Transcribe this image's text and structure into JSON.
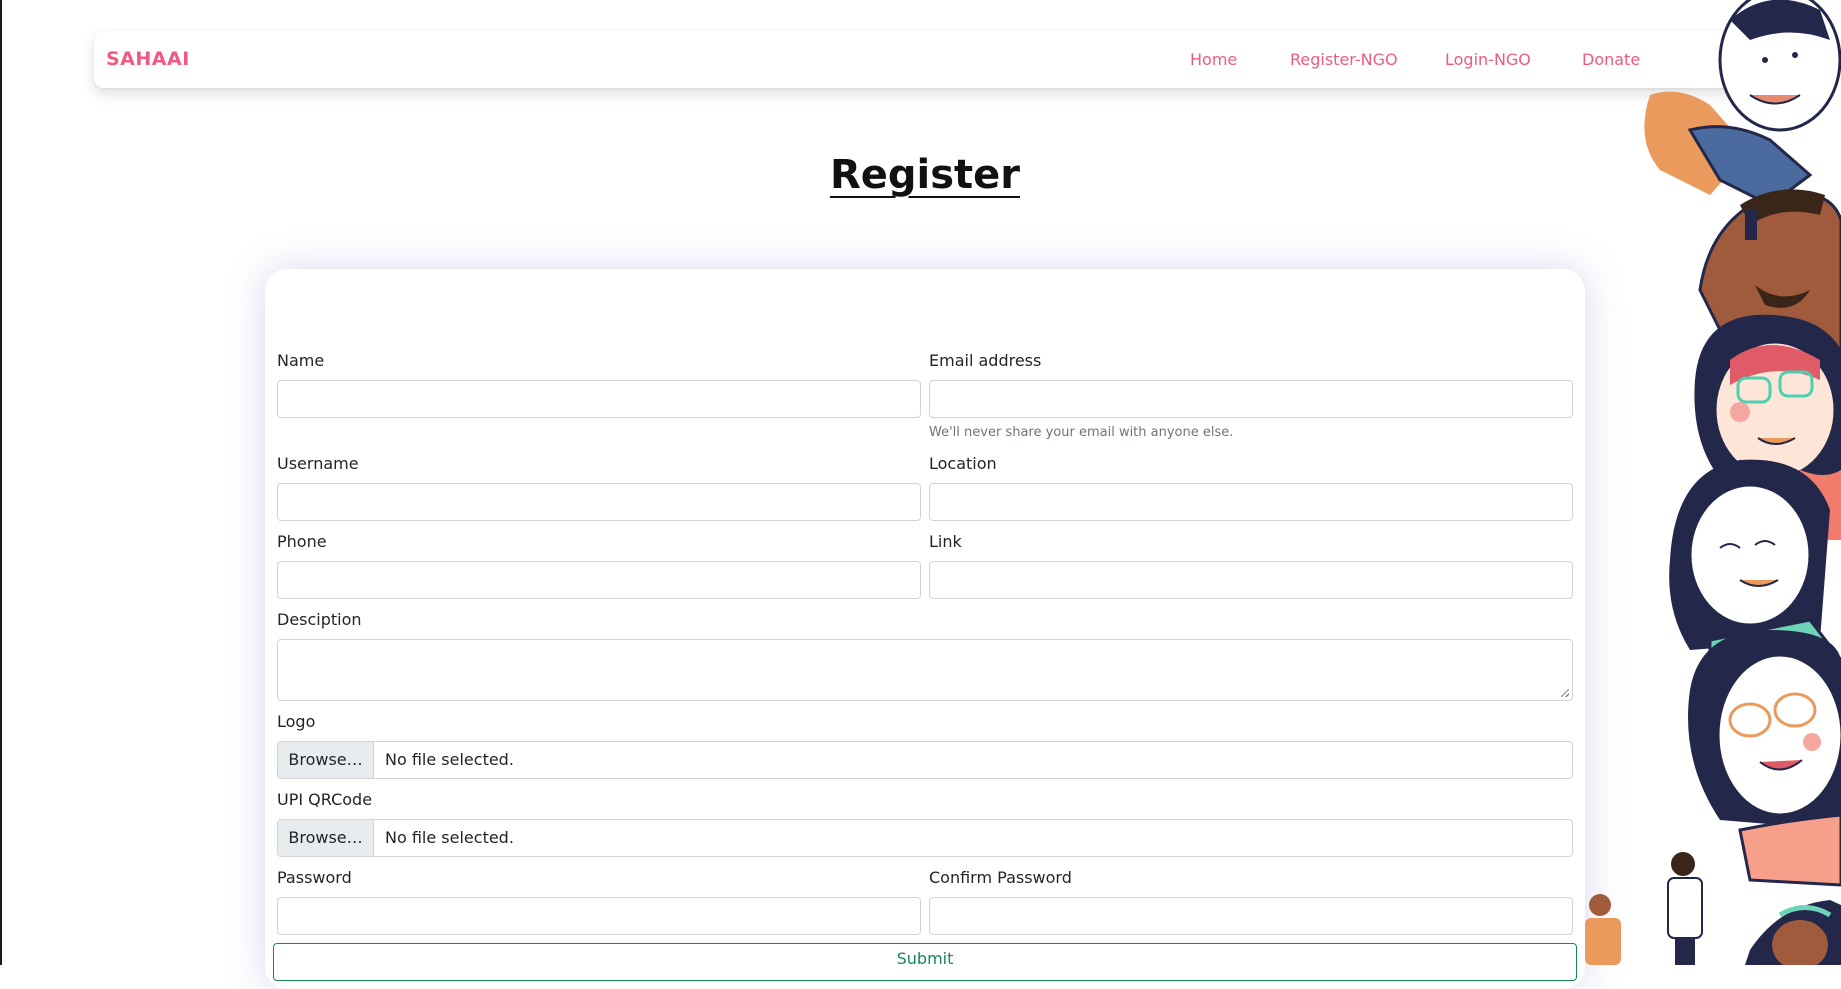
{
  "navbar": {
    "brand": "SAHAAI",
    "links": [
      "Home",
      "Register-NGO",
      "Login-NGO",
      "Donate"
    ]
  },
  "page": {
    "title": "Register"
  },
  "form": {
    "name_label": "Name",
    "email_label": "Email address",
    "email_help": "We'll never share your email with anyone else.",
    "username_label": "Username",
    "location_label": "Location",
    "phone_label": "Phone",
    "link_label": "Link",
    "description_label": "Desciption",
    "logo_label": "Logo",
    "upi_label": "UPI QRCode",
    "browse_label": "Browse…",
    "no_file_text": "No file selected.",
    "password_label": "Password",
    "confirm_password_label": "Confirm Password",
    "submit_label": "Submit"
  },
  "colors": {
    "brand": "#ef5a82",
    "submit": "#198754"
  }
}
